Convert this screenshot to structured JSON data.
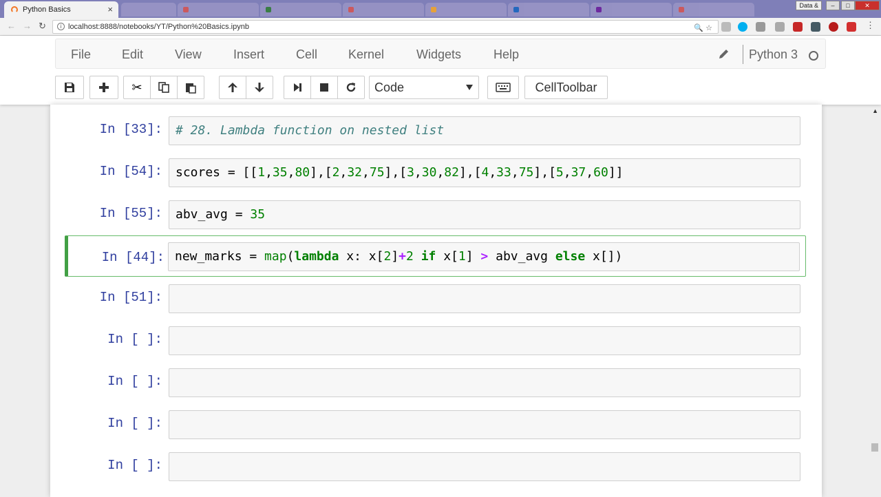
{
  "browser": {
    "active_tab_title": "Python Basics",
    "user_chip": "Data &",
    "url": "localhost:8888/notebooks/YT/Python%20Basics.ipynb"
  },
  "menu": {
    "items": [
      "File",
      "Edit",
      "View",
      "Insert",
      "Cell",
      "Kernel",
      "Widgets",
      "Help"
    ],
    "kernel_name": "Python 3"
  },
  "toolbar": {
    "cell_type": "Code",
    "celltoolbar_label": "CellToolbar"
  },
  "cells": [
    {
      "prompt": "In [33]:",
      "code": "# 28. Lambda function on nested list",
      "selected": false
    },
    {
      "prompt": "In [54]:",
      "code": "scores = [[1,35,80],[2,32,75],[3,30,82],[4,33,75],[5,37,60]]",
      "selected": false
    },
    {
      "prompt": "In [55]:",
      "code": "abv_avg = 35",
      "selected": false
    },
    {
      "prompt": "In [44]:",
      "code": "new_marks = map(lambda x: x[2]+2 if x[1] > abv_avg else x[])",
      "selected": true
    },
    {
      "prompt": "In [51]:",
      "code": "",
      "selected": false
    },
    {
      "prompt": "In [ ]:",
      "code": "",
      "selected": false
    },
    {
      "prompt": "In [ ]:",
      "code": "",
      "selected": false
    },
    {
      "prompt": "In [ ]:",
      "code": "",
      "selected": false
    },
    {
      "prompt": "In [ ]:",
      "code": "",
      "selected": false
    }
  ],
  "colors": {
    "prompt": "#303f9f",
    "selected_border": "#42a045",
    "keyword": "#008000",
    "operator": "#aa22ff",
    "comment": "#408080"
  }
}
